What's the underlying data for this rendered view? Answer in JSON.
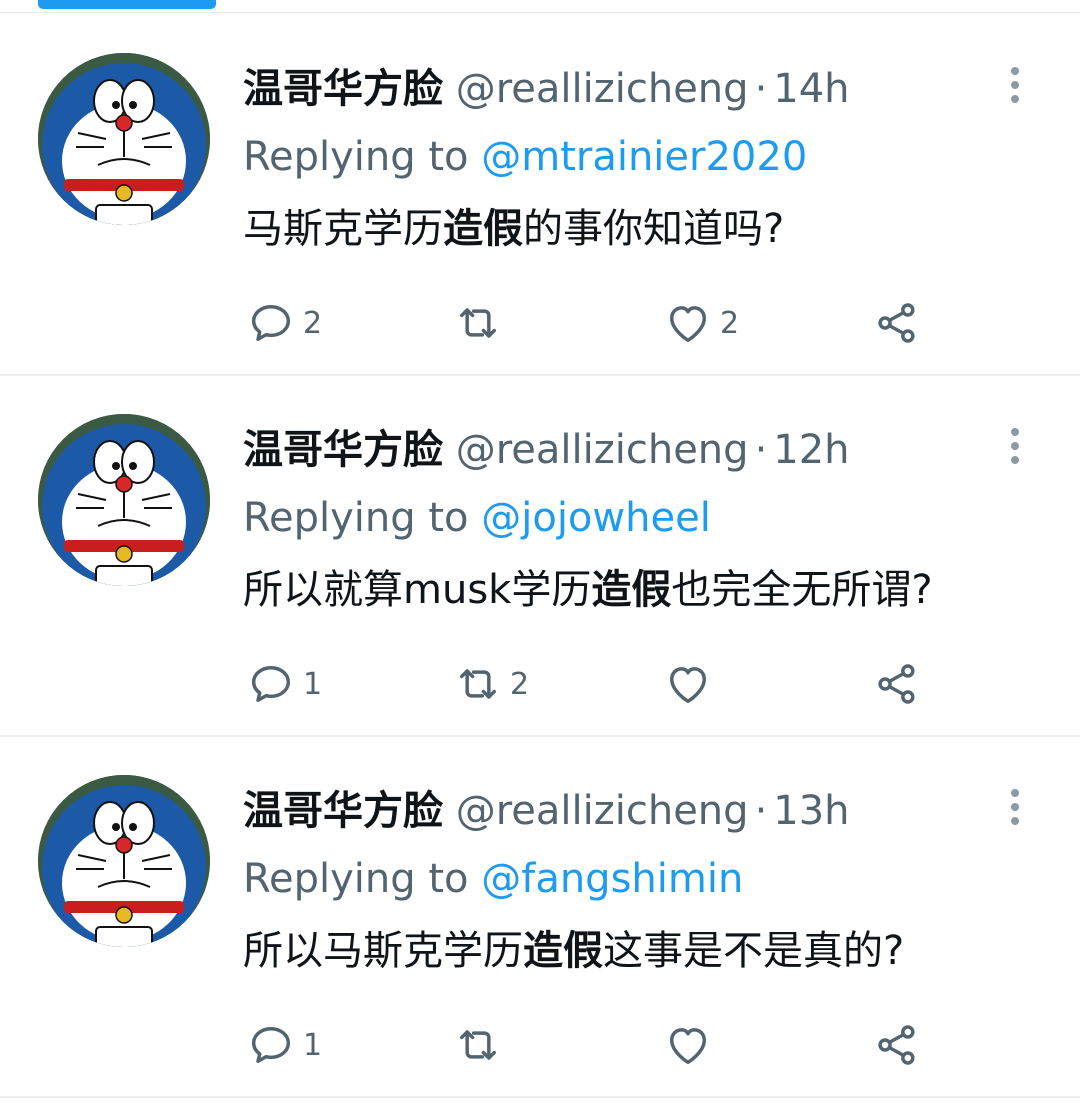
{
  "tweets": [
    {
      "name": "温哥华方脸",
      "handle": "@reallizicheng",
      "separator": "·",
      "time": "14h",
      "replying_label": "Replying to",
      "replying_to": "@mtrainier2020",
      "text_before": "马斯克学历",
      "text_bold": "造假",
      "text_after": "的事你知道吗?",
      "replies": "2",
      "retweets": "",
      "likes": "2"
    },
    {
      "name": "温哥华方脸",
      "handle": "@reallizicheng",
      "separator": "·",
      "time": "12h",
      "replying_label": "Replying to",
      "replying_to": "@jojowheel",
      "text_before": "所以就算musk学历",
      "text_bold": "造假",
      "text_after": "也完全无所谓?",
      "replies": "1",
      "retweets": "2",
      "likes": ""
    },
    {
      "name": "温哥华方脸",
      "handle": "@reallizicheng",
      "separator": "·",
      "time": "13h",
      "replying_label": "Replying to",
      "replying_to": "@fangshimin",
      "text_before": "所以马斯克学历",
      "text_bold": "造假",
      "text_after": "这事是不是真的?",
      "replies": "1",
      "retweets": "",
      "likes": ""
    }
  ],
  "icons": {
    "avatar": "doraemon-avatar-icon",
    "more": "more-vertical-icon",
    "reply": "reply-bubble-icon",
    "retweet": "retweet-icon",
    "like": "heart-icon",
    "share": "share-icon"
  },
  "colors": {
    "accent": "#1d9bf0",
    "text": "#0f1419",
    "secondary": "#536471",
    "divider": "#eceef0"
  }
}
